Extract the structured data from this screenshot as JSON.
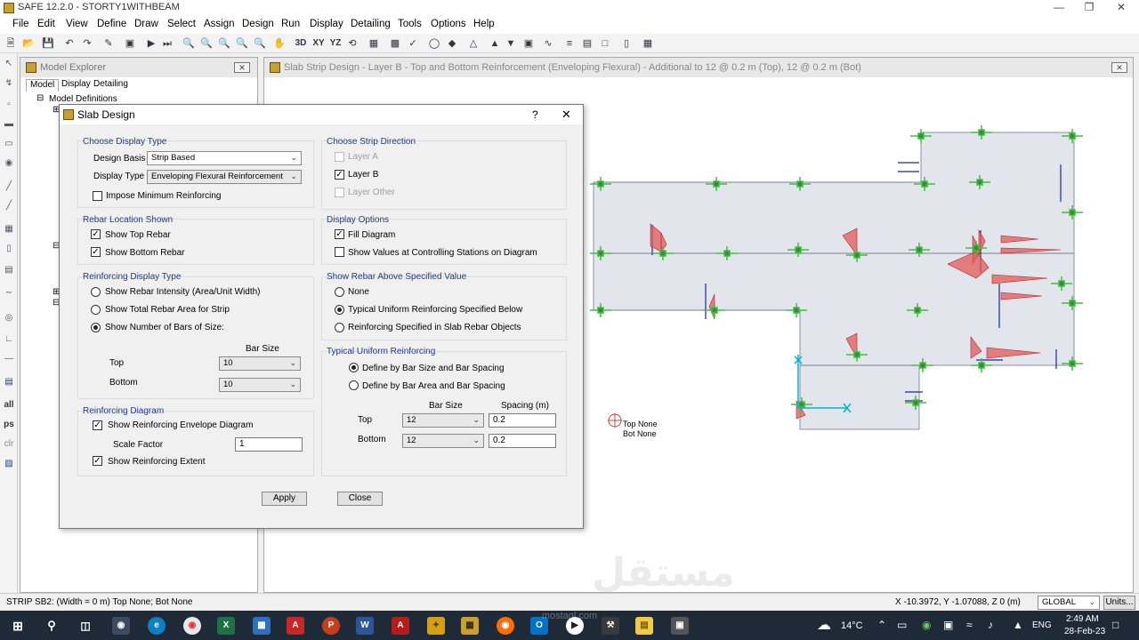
{
  "window": {
    "title": "SAFE 12.2.0 - STORTY1WITHBEAM"
  },
  "menu": [
    "File",
    "Edit",
    "View",
    "Define",
    "Draw",
    "Select",
    "Assign",
    "Design",
    "Run",
    "Display",
    "Detailing",
    "Tools",
    "Options",
    "Help"
  ],
  "toolbar": {
    "labels": {
      "3d": "3D",
      "xy": "XY",
      "yz": "YZ"
    }
  },
  "lefttools": {
    "all": "all",
    "ps": "ps",
    "clr": "clr"
  },
  "explorer": {
    "title": "Model Explorer",
    "tabs": [
      "Model",
      "Display",
      "Detailing"
    ],
    "tree_root": "Model Definitions"
  },
  "viewport": {
    "title": "Slab Strip Design - Layer B - Top and Bottom Reinforcement (Enveloping Flexural) - Additional to 12 @ 0.2 m (Top), 12 @ 0.2 m (Bot)",
    "annotation_top": "Top None",
    "annotation_bot": "Bot None"
  },
  "dialog": {
    "title": "Slab Design",
    "help": "?",
    "display_type_group": {
      "title": "Choose Display Type",
      "design_basis_label": "Design Basis",
      "design_basis_value": "Strip Based",
      "display_type_label": "Display Type",
      "display_type_value": "Enveloping Flexural Reinforcement",
      "impose_min_label": "Impose Minimum Reinforcing"
    },
    "rebar_location_group": {
      "title": "Rebar Location Shown",
      "show_top_label": "Show Top Rebar",
      "show_bottom_label": "Show Bottom Rebar"
    },
    "reinforcing_display_group": {
      "title": "Reinforcing Display Type",
      "opt1": "Show Rebar Intensity (Area/Unit Width)",
      "opt2": "Show Total Rebar Area for Strip",
      "opt3": "Show Number of Bars of Size:",
      "bar_size_header": "Bar Size",
      "top_label": "Top",
      "top_value": "10",
      "bottom_label": "Bottom",
      "bottom_value": "10"
    },
    "reinforcing_diagram_group": {
      "title": "Reinforcing Diagram",
      "show_envelope_label": "Show Reinforcing Envelope Diagram",
      "scale_factor_label": "Scale Factor",
      "scale_factor_value": "1",
      "show_extent_label": "Show Reinforcing Extent"
    },
    "strip_direction_group": {
      "title": "Choose Strip Direction",
      "layer_a": "Layer A",
      "layer_b": "Layer B",
      "layer_other": "Layer Other"
    },
    "display_options_group": {
      "title": "Display Options",
      "fill_diagram": "Fill Diagram",
      "show_values": "Show Values at Controlling Stations on Diagram"
    },
    "rebar_above_group": {
      "title": "Show Rebar Above Specified Value",
      "opt_none": "None",
      "opt_typical": "Typical Uniform Reinforcing Specified Below",
      "opt_slab": "Reinforcing Specified in Slab Rebar Objects"
    },
    "typical_uniform_group": {
      "title": "Typical Uniform Reinforcing",
      "opt_size_spacing": "Define by Bar Size and Bar Spacing",
      "opt_area_spacing": "Define by Bar Area and Bar Spacing",
      "bar_size_header": "Bar Size",
      "spacing_header": "Spacing  (m)",
      "top_label": "Top",
      "top_size": "12",
      "top_spacing": "0.2",
      "bottom_label": "Bottom",
      "bottom_size": "12",
      "bottom_spacing": "0.2"
    },
    "apply_label": "Apply",
    "close_label": "Close"
  },
  "status": {
    "left": "STRIP SB2:  (Width = 0 m)  Top None; Bot None",
    "coords": "X -10.3972,  Y -1.07088,  Z 0 (m)",
    "coord_system": "GLOBAL",
    "units_button": "Units..."
  },
  "taskbar": {
    "weather": "14°C",
    "language": "ENG",
    "time": "2:49 AM",
    "date": "28-Feb-23"
  },
  "watermark": {
    "arabic": "مستقل",
    "latin": "mostaql.com"
  },
  "colors": {
    "accent": "#1f3c88",
    "diagram_fill": "#e05a5a",
    "node": "#3fbf3f",
    "taskbar": "#1f2a38"
  }
}
